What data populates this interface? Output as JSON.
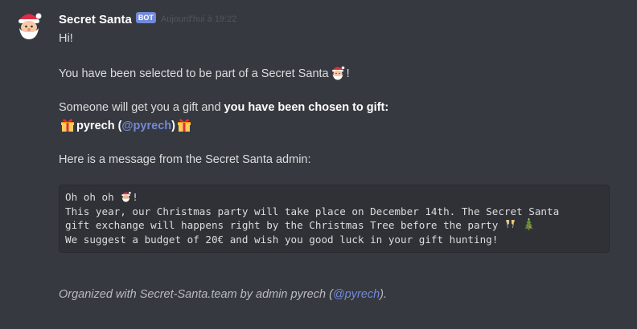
{
  "author": {
    "name": "Secret Santa",
    "tag": "BOT",
    "timestamp": "Aujourd'hui à 19:22",
    "avatar_icon": "santa-icon"
  },
  "message": {
    "greeting": "Hi!",
    "selected_text": "You have been selected to be part of a Secret Santa",
    "selected_end": "!",
    "someone_text": "Someone will get you a gift and ",
    "someone_bold": "you have been chosen to gift:",
    "giftee_name": "pyrech",
    "giftee_open": " (",
    "giftee_mention": "@pyrech",
    "giftee_close": ")",
    "admin_intro": "Here is a message from the Secret Santa admin:"
  },
  "admin_message": {
    "line1": "Oh oh oh ",
    "line1_end": "!",
    "line2": "This year, our Christmas party will take place on December 14th. The Secret Santa",
    "line3": "gift exchange will happens right by the Christmas Tree before the party ",
    "line4": "We suggest a budget of 20€ and wish you good luck in your gift hunting!"
  },
  "footer": {
    "prefix": "Organized with Secret-Santa.team by admin pyrech (",
    "mention": "@pyrech",
    "suffix": ")."
  },
  "colors": {
    "background": "#36393f",
    "mention": "#7289da",
    "bot_tag": "#7289da",
    "code_bg": "#2f3136"
  }
}
